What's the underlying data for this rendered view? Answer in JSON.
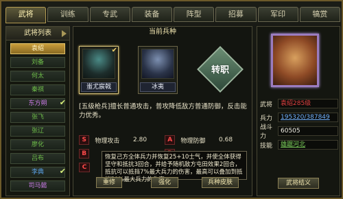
{
  "tabs": [
    "武将",
    "训练",
    "专武",
    "装备",
    "阵型",
    "招募",
    "军印",
    "犒赏"
  ],
  "active_tab": 0,
  "left": {
    "title": "武将列表",
    "generals": [
      {
        "name": "袁绍",
        "style": "selected",
        "check": false
      },
      {
        "name": "刘备",
        "style": "green",
        "check": false
      },
      {
        "name": "何太",
        "style": "green",
        "check": false
      },
      {
        "name": "秦祺",
        "style": "green",
        "check": false
      },
      {
        "name": "东方朔",
        "style": "purple",
        "check": true
      },
      {
        "name": "张飞",
        "style": "green",
        "check": false
      },
      {
        "name": "张辽",
        "style": "green",
        "check": false
      },
      {
        "name": "廖化",
        "style": "green",
        "check": false
      },
      {
        "name": "吕布",
        "style": "green",
        "check": false
      },
      {
        "name": "李典",
        "style": "blue",
        "check": true
      },
      {
        "name": "司马懿",
        "style": "purple",
        "check": false
      }
    ]
  },
  "middle": {
    "title": "当前兵种",
    "cards": [
      {
        "name": "蚩尤宸戟",
        "selected": true
      },
      {
        "name": "冰夷",
        "selected": false
      }
    ],
    "transfer_label": "转职",
    "description": "[五级枪兵]擅长普通攻击，普攻降低敌方普通防御，反击能力优秀。",
    "stats": [
      [
        {
          "grade": "S",
          "label": "物理攻击",
          "value": "2.80"
        },
        {
          "grade": "A",
          "label": "物理防御",
          "value": "0.68"
        }
      ],
      [
        {
          "grade": "B",
          "label": "",
          "value": ""
        },
        {
          "grade": "B",
          "label": "",
          "value": ""
        }
      ],
      [
        {
          "grade": "C",
          "label": "",
          "value": ""
        },
        {
          "grade": "",
          "label": "",
          "value": ""
        }
      ]
    ],
    "tooltip": "恢复己方全体兵力并恢复25+10士气，并使全体获得坚守和抵抗3回合，并给予随机敌方屯田效果2回合，抵抗可以抵挡7%最大兵力的伤害，最高可以叠加到抵挡50%最大兵力的伤害。",
    "buttons": {
      "rebirth": "重修",
      "strengthen": "强化",
      "skin": "兵种皮肤"
    }
  },
  "right": {
    "fields": [
      {
        "k": "武将",
        "v": "袁绍285级",
        "color": "red"
      },
      {
        "k": "兵力",
        "v": "195320/387849",
        "color": "blue",
        "under": true
      },
      {
        "k": "战斗力",
        "v": "60505",
        "color": "white"
      },
      {
        "k": "技能",
        "v": "雄踞河北",
        "color": "green",
        "under": true
      }
    ],
    "bottom_btn": "武将结义"
  }
}
